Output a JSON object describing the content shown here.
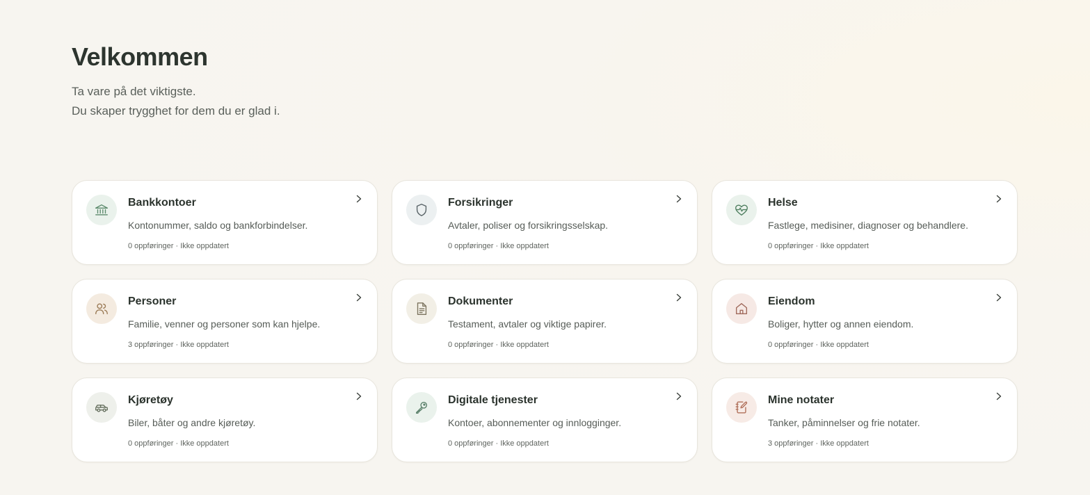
{
  "header": {
    "title": "Velkommen",
    "subtitle_line1": "Ta vare på det viktigste.",
    "subtitle_line2": "Du skaper trygghet for dem du er glad i."
  },
  "cards": [
    {
      "title": "Bankkontoer",
      "description": "Kontonummer, saldo og bankforbindelser.",
      "meta": "0 oppføringer · Ikke oppdatert",
      "icon": "bank-icon",
      "icon_bg": "#eaf2ec",
      "icon_color": "#5c8a6c"
    },
    {
      "title": "Forsikringer",
      "description": "Avtaler, poliser og forsikringsselskap.",
      "meta": "0 oppføringer · Ikke oppdatert",
      "icon": "shield-icon",
      "icon_bg": "#ecf0f1",
      "icon_color": "#5a6468"
    },
    {
      "title": "Helse",
      "description": "Fastlege, medisiner, diagnoser og behandlere.",
      "meta": "0 oppføringer · Ikke oppdatert",
      "icon": "heart-pulse-icon",
      "icon_bg": "#eaf2ec",
      "icon_color": "#4f7f60"
    },
    {
      "title": "Personer",
      "description": "Familie, venner og personer som kan hjelpe.",
      "meta": "3 oppføringer · Ikke oppdatert",
      "icon": "users-icon",
      "icon_bg": "#f4ebe0",
      "icon_color": "#9a7a55"
    },
    {
      "title": "Dokumenter",
      "description": "Testament, avtaler og viktige papirer.",
      "meta": "0 oppføringer · Ikke oppdatert",
      "icon": "document-icon",
      "icon_bg": "#f2efe6",
      "icon_color": "#7d7560"
    },
    {
      "title": "Eiendom",
      "description": "Boliger, hytter og annen eiendom.",
      "meta": "0 oppføringer · Ikke oppdatert",
      "icon": "house-icon",
      "icon_bg": "#f6e9e5",
      "icon_color": "#a06a5c"
    },
    {
      "title": "Kjøretøy",
      "description": "Biler, båter og andre kjøretøy.",
      "meta": "0 oppføringer · Ikke oppdatert",
      "icon": "car-icon",
      "icon_bg": "#eef0eb",
      "icon_color": "#66705f"
    },
    {
      "title": "Digitale tjenester",
      "description": "Kontoer, abonnementer og innlogginger.",
      "meta": "0 oppføringer · Ikke oppdatert",
      "icon": "key-icon",
      "icon_bg": "#eaf2ec",
      "icon_color": "#5a806a"
    },
    {
      "title": "Mine notater",
      "description": "Tanker, påminnelser og frie notater.",
      "meta": "3 oppføringer · Ikke oppdatert",
      "icon": "notebook-pen-icon",
      "icon_bg": "#f7ebe6",
      "icon_color": "#b0705a"
    }
  ]
}
